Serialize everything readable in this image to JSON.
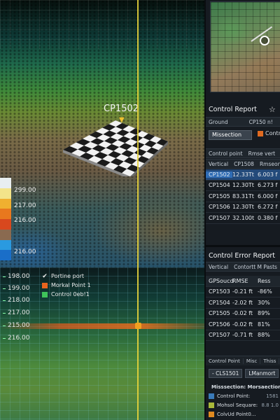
{
  "viewport": {
    "control_point_label": "CP1502",
    "color_scale": {
      "colors": [
        "#e8eef0",
        "#f3e48a",
        "#f0b030",
        "#e8781e",
        "#d8481e",
        "#8a6a50",
        "#2a9ae0",
        "#1a6ec8"
      ],
      "labels": [
        "299.00",
        "217.00",
        "216.00",
        "216.00"
      ]
    },
    "elevation_labels": [
      "198.00",
      "199.00",
      "218.00",
      "217.00",
      "215.00",
      "216.00"
    ],
    "legend": [
      {
        "type": "check",
        "label": "Portine port"
      },
      {
        "type": "swatch",
        "color": "#e8641e",
        "label": "Morkal Point 1"
      },
      {
        "type": "swatch",
        "color": "#3fc45a",
        "label": "Control 0eb!1"
      }
    ]
  },
  "panel": {
    "control_report": {
      "title": "Control Report",
      "header": [
        "Ground",
        "CP150 n!"
      ],
      "section_button": "Missection",
      "control_option": "Control",
      "columns_row": [
        "Control point",
        "Rmse vert"
      ],
      "subheader": [
        "Vertical",
        "CP1508",
        "Rmseon"
      ],
      "rows": [
        {
          "id": "CP1502",
          "v1": "12.33Tt",
          "v2": "6.003 f",
          "selected": true
        },
        {
          "id": "CP1504",
          "v1": "12.30Tt",
          "v2": "6.273 f",
          "selected": false
        },
        {
          "id": "CP1505",
          "v1": "83.31Tt",
          "v2": "6.000 f",
          "selected": false
        },
        {
          "id": "CP1506",
          "v1": "12.30Tt",
          "v2": "6.272 f",
          "selected": false
        },
        {
          "id": "CP1507",
          "v1": "32.100t",
          "v2": "0.380 f",
          "selected": false
        }
      ]
    },
    "error_report": {
      "title": "Control Error Report",
      "subheader": [
        "Vertical",
        "Contortt M Pasts"
      ],
      "columns": [
        "GPSoucd",
        "RMSE",
        "Ress"
      ],
      "rows": [
        {
          "id": "CP1503",
          "rmse": "-0.21 ft",
          "pct": "-86%"
        },
        {
          "id": "CP1504",
          "rmse": "-2.02 ft",
          "pct": "30%"
        },
        {
          "id": "CP1505",
          "rmse": "-0.02 ft",
          "pct": "89%"
        },
        {
          "id": "CP1506",
          "rmse": "-0.02 ft",
          "pct": "81%"
        },
        {
          "id": "CP1507",
          "rmse": "-0.71 ft",
          "pct": "88%"
        }
      ]
    },
    "footer_tabs": [
      "Control Point",
      "Misc",
      "Thiss"
    ],
    "footer_buttons": [
      "- CLS1501",
      "LManmort"
    ],
    "legend": [
      {
        "color": "#3fc45a",
        "label": "Misssection: Morsaection",
        "value": ""
      },
      {
        "color": "#3a7ab8",
        "label": "Control Point:",
        "value": "1581"
      },
      {
        "color": "#a9b83a",
        "label": "Mohsol Sequare:",
        "value": "8.8  1.0"
      },
      {
        "color": "#e08a20",
        "label": "ColvUd Point0...",
        "value": ""
      }
    ]
  }
}
